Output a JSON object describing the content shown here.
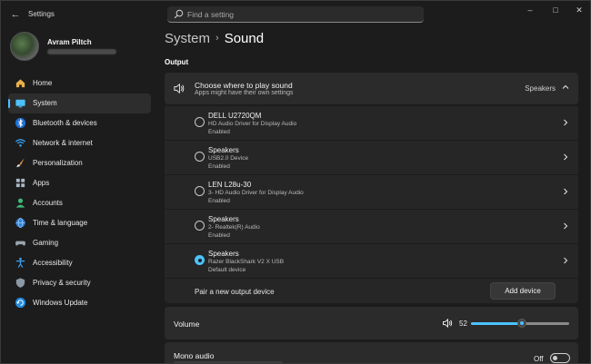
{
  "window": {
    "title": "Settings",
    "back_icon": "back-arrow-icon",
    "controls": [
      "minimize-icon",
      "maximize-icon",
      "close-icon"
    ]
  },
  "search": {
    "placeholder": "Find a setting",
    "value": ""
  },
  "profile": {
    "name": "Avram Piltch"
  },
  "sidebar": {
    "items": [
      {
        "label": "Home",
        "icon": "home-icon",
        "active": false
      },
      {
        "label": "System",
        "icon": "system-icon",
        "active": true
      },
      {
        "label": "Bluetooth & devices",
        "icon": "bluetooth-icon",
        "active": false
      },
      {
        "label": "Network & internet",
        "icon": "wifi-icon",
        "active": false
      },
      {
        "label": "Personalization",
        "icon": "brush-icon",
        "active": false
      },
      {
        "label": "Apps",
        "icon": "apps-icon",
        "active": false
      },
      {
        "label": "Accounts",
        "icon": "accounts-icon",
        "active": false
      },
      {
        "label": "Time & language",
        "icon": "globe-icon",
        "active": false
      },
      {
        "label": "Gaming",
        "icon": "gamepad-icon",
        "active": false
      },
      {
        "label": "Accessibility",
        "icon": "accessibility-icon",
        "active": false
      },
      {
        "label": "Privacy & security",
        "icon": "shield-icon",
        "active": false
      },
      {
        "label": "Windows Update",
        "icon": "update-icon",
        "active": false
      }
    ]
  },
  "breadcrumb": {
    "parent": "System",
    "current": "Sound"
  },
  "output": {
    "section_title": "Output",
    "header": {
      "title": "Choose where to play sound",
      "subtitle": "Apps might have their own settings",
      "value": "Speakers"
    },
    "devices": [
      {
        "name": "DELL U2720QM",
        "driver": "HD Audio Driver for Display Audio",
        "status": "Enabled",
        "selected": false
      },
      {
        "name": "Speakers",
        "driver": "USB2.0 Device",
        "status": "Enabled",
        "selected": false
      },
      {
        "name": "LEN L28u-30",
        "driver": "3- HD Audio Driver for Display Audio",
        "status": "Enabled",
        "selected": false
      },
      {
        "name": "Speakers",
        "driver": "2- Realtek(R) Audio",
        "status": "Enabled",
        "selected": false
      },
      {
        "name": "Speakers",
        "driver": "Razer BlackShark V2 X USB",
        "status": "Default device",
        "selected": true
      }
    ],
    "pair": {
      "label": "Pair a new output device",
      "button": "Add device"
    }
  },
  "volume": {
    "label": "Volume",
    "value": "52",
    "level": 52
  },
  "mono": {
    "label": "Mono audio",
    "state": "Off"
  },
  "colors": {
    "accent": "#4cc2ff",
    "background": "#1c1c1c",
    "card": "#2b2b2b"
  }
}
